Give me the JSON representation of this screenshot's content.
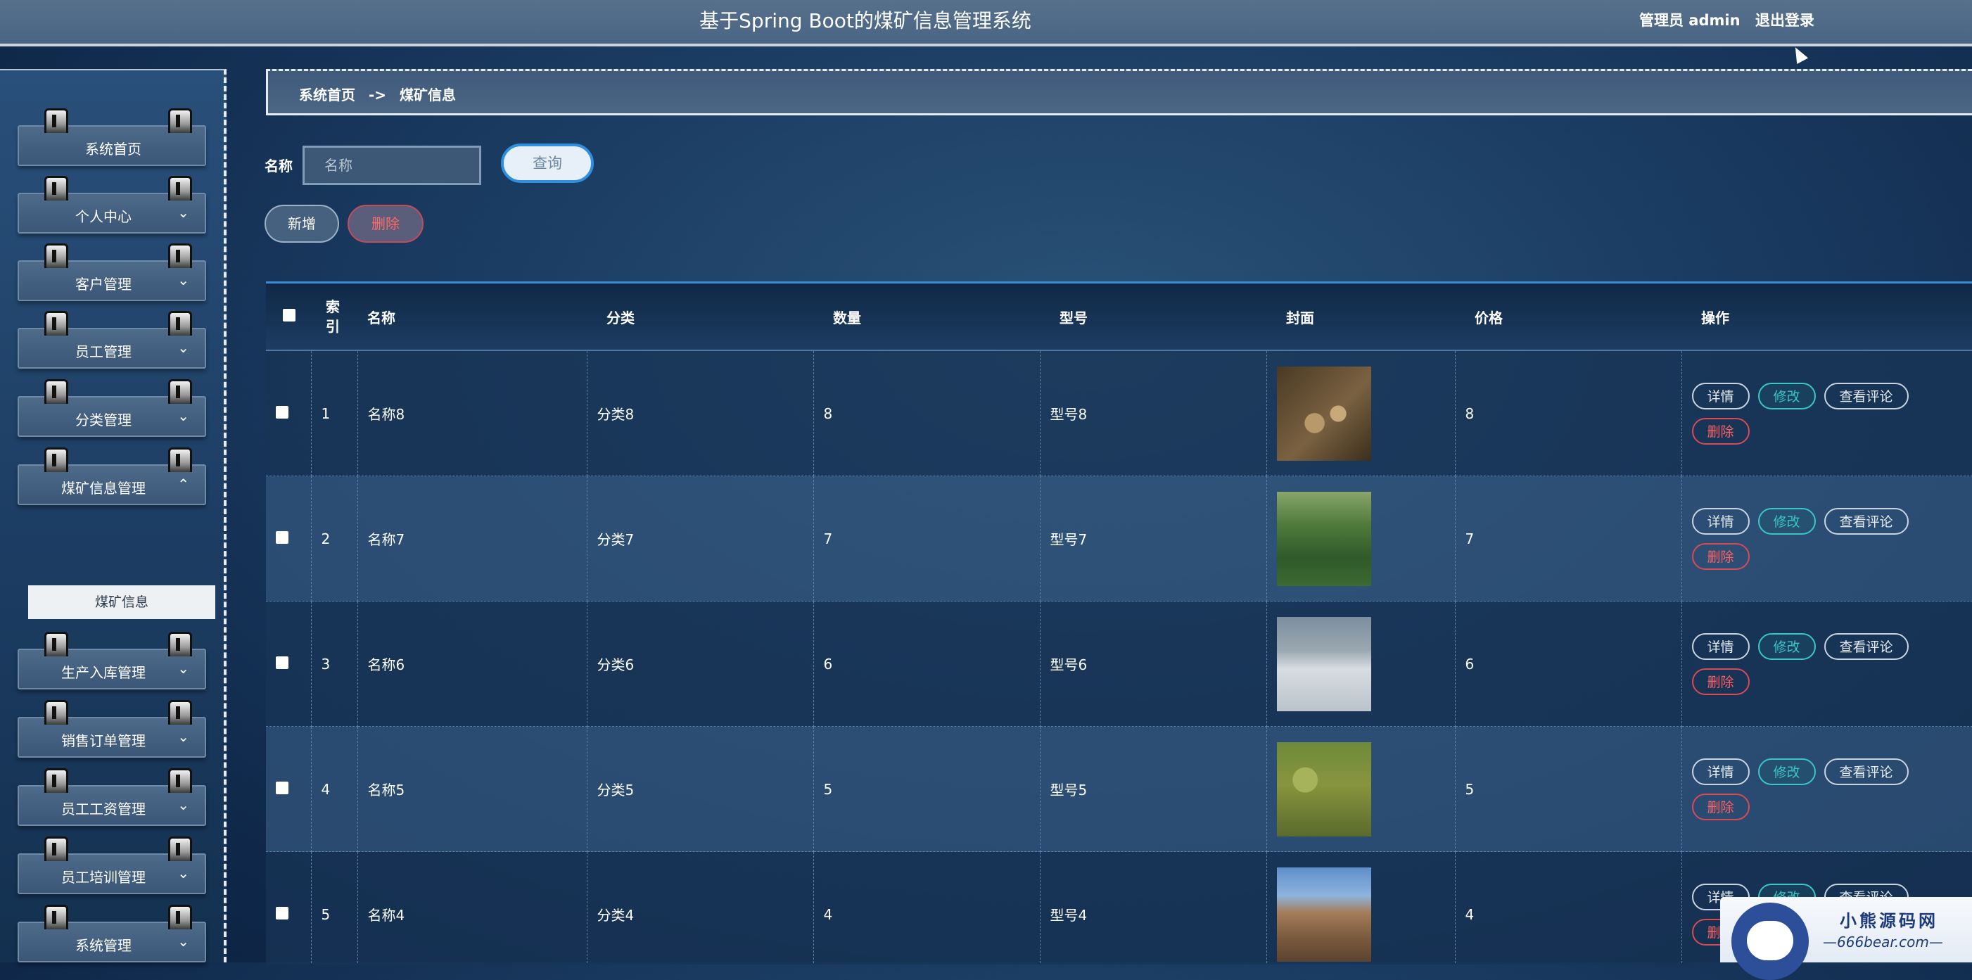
{
  "header": {
    "title": "基于Spring Boot的煤矿信息管理系统",
    "role": "管理员 admin",
    "logout": "退出登录"
  },
  "sidebar": {
    "items": [
      {
        "label": "系统首页",
        "arrow": ""
      },
      {
        "label": "个人中心",
        "arrow": "⌄"
      },
      {
        "label": "客户管理",
        "arrow": "⌄"
      },
      {
        "label": "员工管理",
        "arrow": "⌄"
      },
      {
        "label": "分类管理",
        "arrow": "⌄"
      },
      {
        "label": "煤矿信息管理",
        "arrow": "⌃"
      },
      {
        "label": "生产入库管理",
        "arrow": "⌄"
      },
      {
        "label": "销售订单管理",
        "arrow": "⌄"
      },
      {
        "label": "员工工资管理",
        "arrow": "⌄"
      },
      {
        "label": "员工培训管理",
        "arrow": "⌄"
      },
      {
        "label": "系统管理",
        "arrow": "⌄"
      }
    ],
    "sub_item": "煤矿信息"
  },
  "breadcrumb": {
    "home": "系统首页",
    "sep": "->",
    "current": "煤矿信息"
  },
  "search": {
    "label": "名称",
    "placeholder": "名称",
    "button": "查询"
  },
  "actions": {
    "add": "新增",
    "delete": "删除"
  },
  "table": {
    "headers": {
      "index": "索引",
      "name": "名称",
      "category": "分类",
      "quantity": "数量",
      "model": "型号",
      "cover": "封面",
      "price": "价格",
      "ops": "操作"
    },
    "op_labels": {
      "detail": "详情",
      "edit": "修改",
      "comments": "查看评论",
      "delete": "删除"
    },
    "rows": [
      {
        "index": "1",
        "name": "名称8",
        "category": "分类8",
        "quantity": "8",
        "model": "型号8",
        "price": "8"
      },
      {
        "index": "2",
        "name": "名称7",
        "category": "分类7",
        "quantity": "7",
        "model": "型号7",
        "price": "7"
      },
      {
        "index": "3",
        "name": "名称6",
        "category": "分类6",
        "quantity": "6",
        "model": "型号6",
        "price": "6"
      },
      {
        "index": "4",
        "name": "名称5",
        "category": "分类5",
        "quantity": "5",
        "model": "型号5",
        "price": "5"
      },
      {
        "index": "5",
        "name": "名称4",
        "category": "分类4",
        "quantity": "4",
        "model": "型号4",
        "price": "4"
      }
    ]
  },
  "watermark": {
    "name": "小熊源码网",
    "url": "—666bear.com—"
  }
}
